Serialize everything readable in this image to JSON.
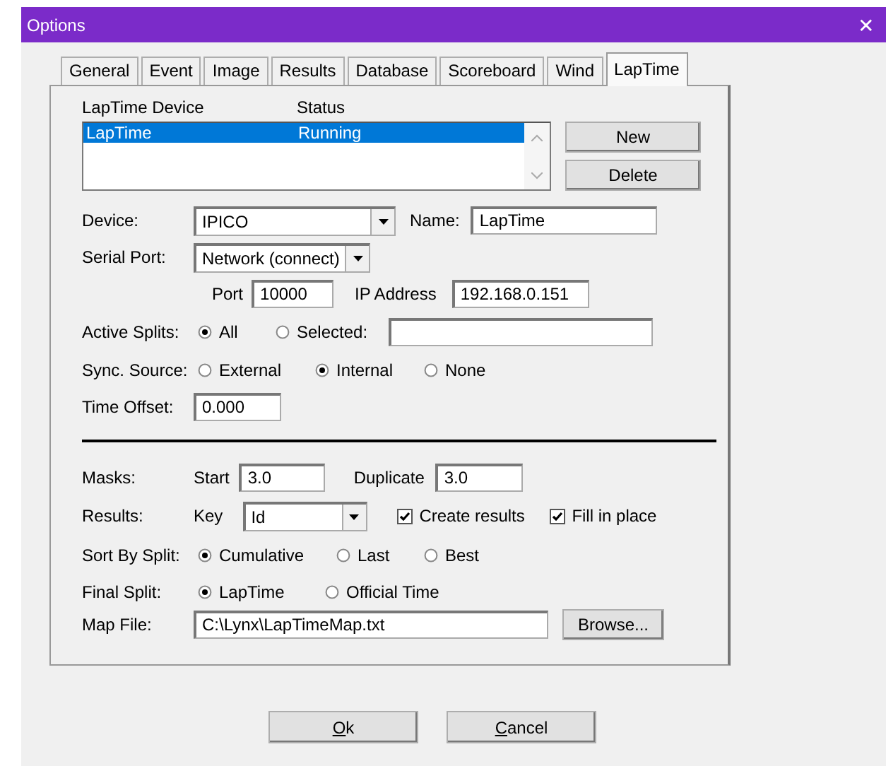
{
  "window": {
    "title": "Options",
    "close": "✕"
  },
  "tabs": [
    {
      "label": "General",
      "selected": false
    },
    {
      "label": "Event",
      "selected": false
    },
    {
      "label": "Image",
      "selected": false
    },
    {
      "label": "Results",
      "selected": false
    },
    {
      "label": "Database",
      "selected": false
    },
    {
      "label": "Scoreboard",
      "selected": false
    },
    {
      "label": "Wind",
      "selected": false
    },
    {
      "label": "LapTime",
      "selected": true
    }
  ],
  "device_list": {
    "columns": [
      "LapTime Device",
      "Status"
    ],
    "rows": [
      {
        "cells": [
          "LapTime",
          "Running"
        ],
        "selected": true
      }
    ]
  },
  "list_buttons": [
    "New",
    "Delete"
  ],
  "device": {
    "label": "Device:",
    "value": "IPICO",
    "name_label": "Name:",
    "name_value": "LapTime"
  },
  "serial_port": {
    "label": "Serial Port:",
    "value": "Network (connect)"
  },
  "connection": {
    "port_label": "Port",
    "port_value": "10000",
    "ip_label": "IP Address",
    "ip_value": "192.168.0.151"
  },
  "active_splits": {
    "label": "Active Splits:",
    "options": [
      {
        "label": "All",
        "selected": true
      },
      {
        "label": "Selected:",
        "selected": false
      }
    ]
  },
  "sync_source": {
    "label": "Sync. Source:",
    "options": [
      {
        "label": "External",
        "selected": false
      },
      {
        "label": "Internal",
        "selected": true
      },
      {
        "label": "None",
        "selected": false
      }
    ]
  },
  "time_offset": {
    "label": "Time Offset:",
    "value": "0.000"
  },
  "masks": {
    "label": "Masks:",
    "start_label": "Start",
    "start_value": "3.0",
    "duplicate_label": "Duplicate",
    "duplicate_value": "3.0"
  },
  "results": {
    "label": "Results:",
    "key_label": "Key",
    "key_value": "Id",
    "checkboxes": [
      {
        "label": "Create results",
        "checked": true
      },
      {
        "label": "Fill in place",
        "checked": true
      }
    ]
  },
  "sort_by_split": {
    "label": "Sort By Split:",
    "options": [
      {
        "label": "Cumulative",
        "selected": true
      },
      {
        "label": "Last",
        "selected": false
      },
      {
        "label": "Best",
        "selected": false
      }
    ]
  },
  "final_split": {
    "label": "Final Split:",
    "options": [
      {
        "label": "LapTime",
        "selected": true
      },
      {
        "label": "Official Time",
        "selected": false
      }
    ]
  },
  "map_file": {
    "label": "Map File:",
    "value": "C:\\Lynx\\LapTimeMap.txt",
    "button": "Browse..."
  },
  "footer_buttons": [
    {
      "access_key": "O",
      "rest": "k"
    },
    {
      "access_key": "C",
      "rest": "ancel"
    }
  ]
}
